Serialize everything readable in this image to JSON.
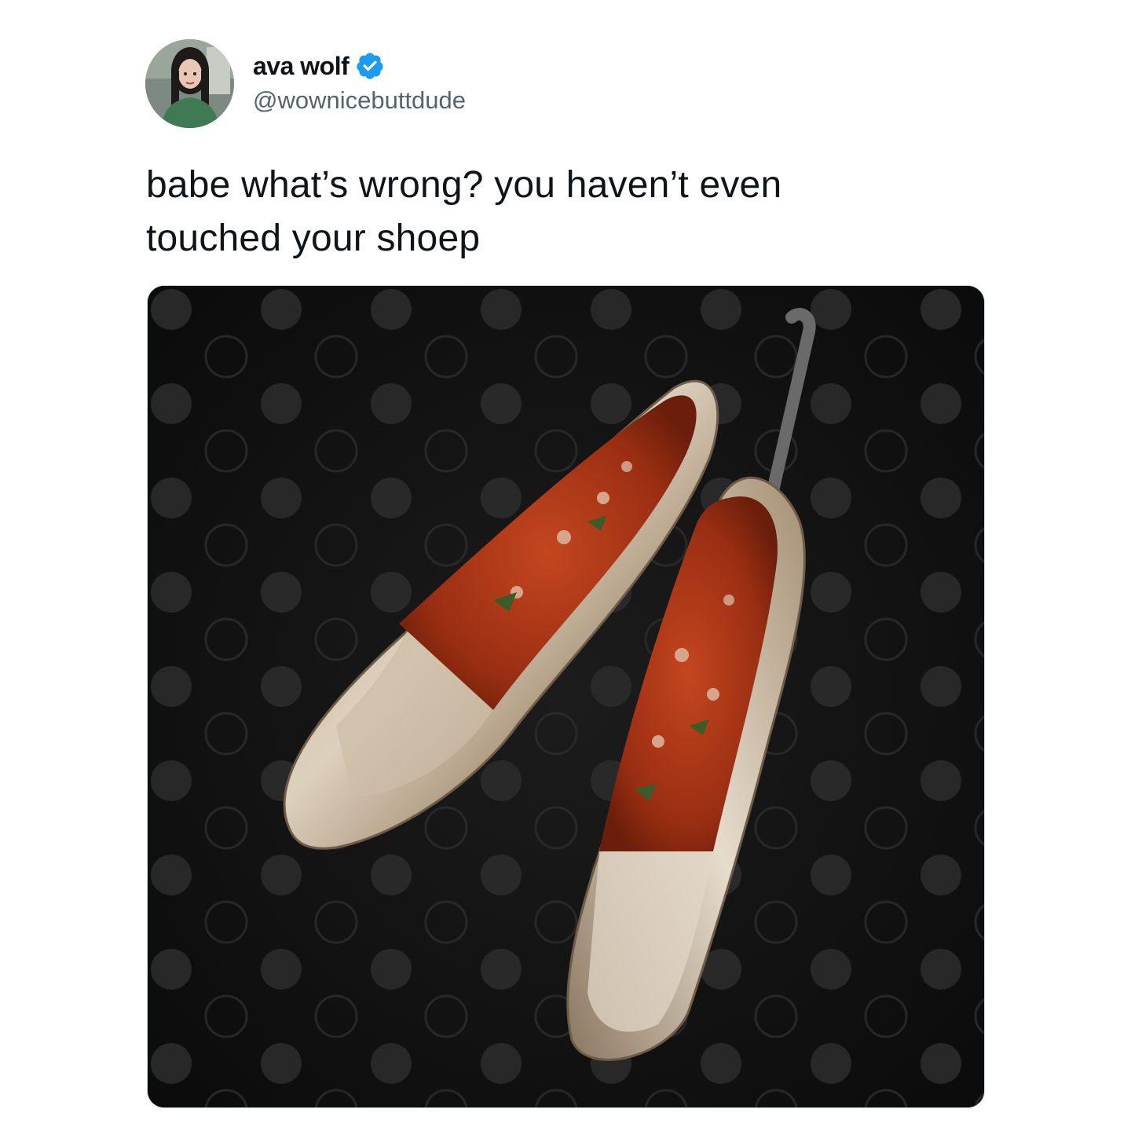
{
  "author": {
    "display_name": "ava wolf",
    "handle": "@wownicebuttdude",
    "verified": true,
    "verified_color": "#1d9bf0",
    "avatar_icon": "profile-photo"
  },
  "tweet": {
    "text_line_1": "babe what’s wrong? you haven’t even",
    "text_line_2": "touched your shoep"
  },
  "media": {
    "kind": "photo",
    "subject": "shoes-filled-with-soup-with-spoon"
  },
  "colors": {
    "text_primary": "#0f1419",
    "text_secondary": "#536471",
    "media_border": "#cfd9de"
  }
}
